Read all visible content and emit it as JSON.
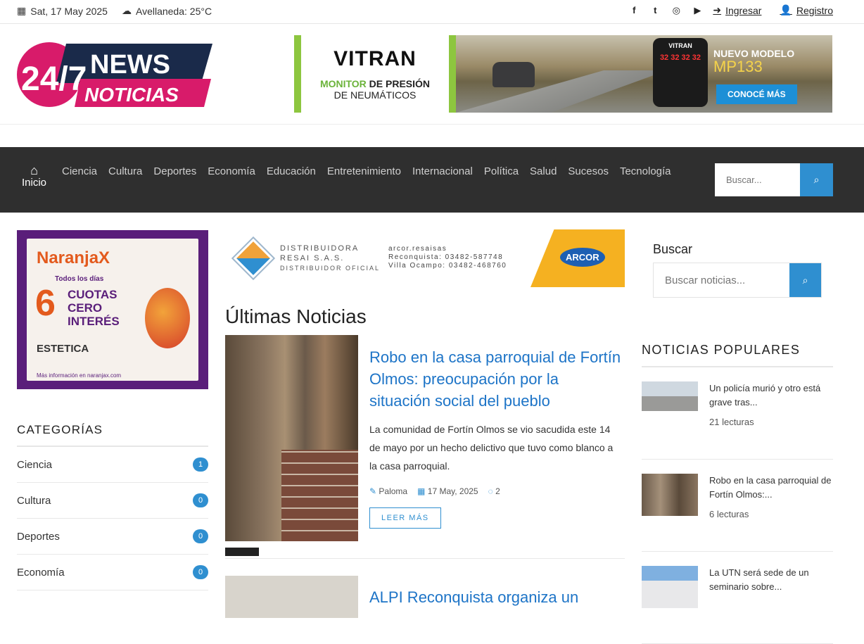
{
  "topbar": {
    "date": "Sat, 17 May 2025",
    "weather": "Avellaneda: 25°C",
    "social_icons": [
      "facebook-icon",
      "twitter-icon",
      "instagram-icon",
      "youtube-icon"
    ],
    "login": "Ingresar",
    "register": "Registro"
  },
  "logo": {
    "line1": "24/7",
    "line2": "NEWS",
    "line3": "NOTICIAS"
  },
  "banner": {
    "brand": "VITRAN",
    "line1a": "MONITOR",
    "line1b": " DE PRESIÓN",
    "line2": "DE NEUMÁTICOS",
    "device_brand": "VITRAN",
    "device_readout": "32 32 32 32",
    "new_model": "NUEVO MODELO",
    "model": "MP133",
    "cta": "CONOCÉ MÁS"
  },
  "nav": {
    "home": "Inicio",
    "items": [
      "Ciencia",
      "Cultura",
      "Deportes",
      "Economía",
      "Educación",
      "Entretenimiento",
      "Internacional",
      "Política",
      "Salud",
      "Sucesos",
      "Tecnología"
    ],
    "search_placeholder": "Buscar..."
  },
  "ad_naranja": {
    "brand": "NaranjaX",
    "days": "Todos los días",
    "number": "6",
    "text1": "CUOTAS",
    "text2": "CERO",
    "text3": "INTERÉS",
    "partner": "ESTETICA",
    "footer": "Más información en naranjax.com"
  },
  "categories": {
    "title": "CATEGORÍAS",
    "items": [
      {
        "name": "Ciencia",
        "count": "1"
      },
      {
        "name": "Cultura",
        "count": "0"
      },
      {
        "name": "Deportes",
        "count": "0"
      },
      {
        "name": "Economía",
        "count": "0"
      }
    ]
  },
  "ad_arcor": {
    "dist_line1": "DISTRIBUIDORA",
    "dist_line2": "RESAI S.A.S.",
    "dist_line3": "DISTRIBUIDOR OFICIAL",
    "contact1": "arcor.resaisas",
    "contact2": "Reconquista: 03482-587748",
    "contact3": "Villa Ocampo: 03482-468760",
    "brand": "ARCOR"
  },
  "latest": {
    "title": "Últimas Noticias",
    "article": {
      "title": "Robo en la casa parroquial de Fortín Olmos: preocupación por la situación social del pueblo",
      "excerpt": "La comunidad de Fortín Olmos se vio sacudida este 14 de mayo por un hecho delictivo que tuvo como blanco a la casa parroquial.",
      "author": "Paloma",
      "date": "17 May, 2025",
      "comments": "2",
      "more": "LEER MÁS"
    },
    "article2_title": "ALPI Reconquista organiza un"
  },
  "sidebar": {
    "search_title": "Buscar",
    "search_placeholder": "Buscar noticias...",
    "popular_title": "NOTICIAS POPULARES",
    "popular": [
      {
        "title": "Un policía murió y otro está grave tras...",
        "reads": "21 lecturas"
      },
      {
        "title": "Robo en la casa parroquial de Fortín Olmos:...",
        "reads": "6 lecturas"
      },
      {
        "title": "La UTN será sede de un seminario sobre...",
        "reads": ""
      }
    ]
  },
  "colors": {
    "accent": "#2f8fd0",
    "nav_bg": "#2f2f2f",
    "link": "#1d74c7",
    "logo_pink": "#d81b6a",
    "logo_navy": "#1a2a4a"
  }
}
